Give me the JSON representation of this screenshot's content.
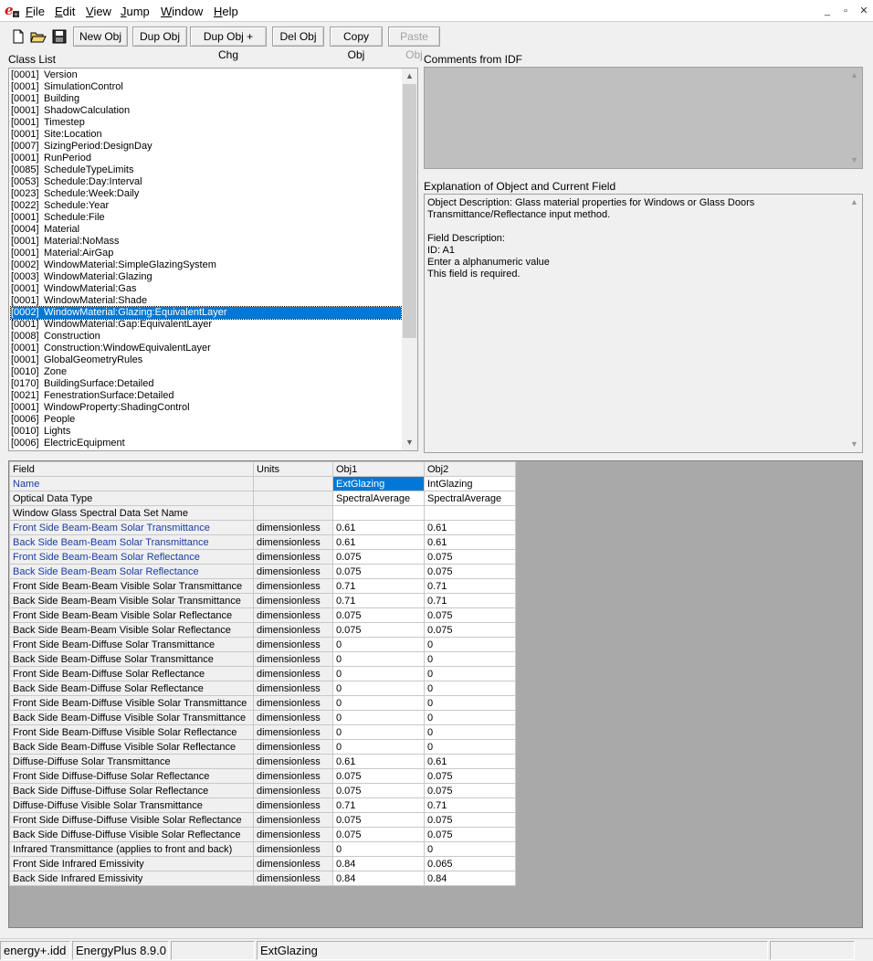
{
  "menu": [
    "File",
    "Edit",
    "View",
    "Jump",
    "Window",
    "Help"
  ],
  "window_buttons": [
    "_",
    "▫",
    "✕"
  ],
  "toolbar": {
    "new_obj": "New Obj",
    "dup_obj": "Dup Obj",
    "dup_obj_chg": "Dup Obj + Chg",
    "del_obj": "Del Obj",
    "copy_obj": "Copy Obj",
    "paste_obj": "Paste Obj"
  },
  "labels": {
    "class_list": "Class List",
    "comments": "Comments from IDF",
    "explanation": "Explanation of Object and Current Field"
  },
  "class_list": [
    {
      "count": "[0001]",
      "name": "Version"
    },
    {
      "count": "[0001]",
      "name": "SimulationControl"
    },
    {
      "count": "[0001]",
      "name": "Building"
    },
    {
      "count": "[0001]",
      "name": "ShadowCalculation"
    },
    {
      "count": "[0001]",
      "name": "Timestep"
    },
    {
      "count": "[0001]",
      "name": "Site:Location"
    },
    {
      "count": "[0007]",
      "name": "SizingPeriod:DesignDay"
    },
    {
      "count": "[0001]",
      "name": "RunPeriod"
    },
    {
      "count": "[0085]",
      "name": "ScheduleTypeLimits"
    },
    {
      "count": "[0053]",
      "name": "Schedule:Day:Interval"
    },
    {
      "count": "[0023]",
      "name": "Schedule:Week:Daily"
    },
    {
      "count": "[0022]",
      "name": "Schedule:Year"
    },
    {
      "count": "[0001]",
      "name": "Schedule:File"
    },
    {
      "count": "[0004]",
      "name": "Material"
    },
    {
      "count": "[0001]",
      "name": "Material:NoMass"
    },
    {
      "count": "[0001]",
      "name": "Material:AirGap"
    },
    {
      "count": "[0002]",
      "name": "WindowMaterial:SimpleGlazingSystem"
    },
    {
      "count": "[0003]",
      "name": "WindowMaterial:Glazing"
    },
    {
      "count": "[0001]",
      "name": "WindowMaterial:Gas"
    },
    {
      "count": "[0001]",
      "name": "WindowMaterial:Shade"
    },
    {
      "count": "[0002]",
      "name": "WindowMaterial:Glazing:EquivalentLayer",
      "selected": true
    },
    {
      "count": "[0001]",
      "name": "WindowMaterial:Gap:EquivalentLayer"
    },
    {
      "count": "[0008]",
      "name": "Construction"
    },
    {
      "count": "[0001]",
      "name": "Construction:WindowEquivalentLayer"
    },
    {
      "count": "[0001]",
      "name": "GlobalGeometryRules"
    },
    {
      "count": "[0010]",
      "name": "Zone"
    },
    {
      "count": "[0170]",
      "name": "BuildingSurface:Detailed"
    },
    {
      "count": "[0021]",
      "name": "FenestrationSurface:Detailed"
    },
    {
      "count": "[0001]",
      "name": "WindowProperty:ShadingControl"
    },
    {
      "count": "[0006]",
      "name": "People"
    },
    {
      "count": "[0010]",
      "name": "Lights"
    },
    {
      "count": "[0006]",
      "name": "ElectricEquipment"
    }
  ],
  "explanation": [
    "Object Description: Glass material properties for Windows or Glass Doors",
    "Transmittance/Reflectance input method.",
    "",
    "Field Description:",
    "ID: A1",
    "Enter a alphanumeric value",
    "This field is required."
  ],
  "grid": {
    "headers": [
      "Field",
      "Units",
      "Obj1",
      "Obj2"
    ],
    "rows": [
      {
        "field": "Name",
        "units": "",
        "obj1": "ExtGlazing",
        "obj2": "IntGlazing",
        "required": true,
        "selected": true
      },
      {
        "field": "Optical Data Type",
        "units": "",
        "obj1": "SpectralAverage",
        "obj2": "SpectralAverage"
      },
      {
        "field": "Window Glass Spectral Data Set Name",
        "units": "",
        "obj1": "",
        "obj2": ""
      },
      {
        "field": "Front Side Beam-Beam Solar Transmittance",
        "units": "dimensionless",
        "obj1": "0.61",
        "obj2": "0.61",
        "required": true
      },
      {
        "field": "Back Side Beam-Beam Solar Transmittance",
        "units": "dimensionless",
        "obj1": "0.61",
        "obj2": "0.61",
        "required": true
      },
      {
        "field": "Front Side Beam-Beam Solar Reflectance",
        "units": "dimensionless",
        "obj1": "0.075",
        "obj2": "0.075",
        "required": true
      },
      {
        "field": "Back Side Beam-Beam Solar Reflectance",
        "units": "dimensionless",
        "obj1": "0.075",
        "obj2": "0.075",
        "required": true
      },
      {
        "field": "Front Side Beam-Beam Visible Solar Transmittance",
        "units": "dimensionless",
        "obj1": "0.71",
        "obj2": "0.71"
      },
      {
        "field": "Back Side Beam-Beam Visible Solar Transmittance",
        "units": "dimensionless",
        "obj1": "0.71",
        "obj2": "0.71"
      },
      {
        "field": "Front Side Beam-Beam Visible Solar Reflectance",
        "units": "dimensionless",
        "obj1": "0.075",
        "obj2": "0.075"
      },
      {
        "field": "Back Side Beam-Beam Visible Solar Reflectance",
        "units": "dimensionless",
        "obj1": "0.075",
        "obj2": "0.075"
      },
      {
        "field": "Front Side Beam-Diffuse Solar Transmittance",
        "units": "dimensionless",
        "obj1": "0",
        "obj2": "0"
      },
      {
        "field": "Back Side Beam-Diffuse Solar Transmittance",
        "units": "dimensionless",
        "obj1": "0",
        "obj2": "0"
      },
      {
        "field": "Front Side Beam-Diffuse Solar Reflectance",
        "units": "dimensionless",
        "obj1": "0",
        "obj2": "0"
      },
      {
        "field": "Back Side Beam-Diffuse Solar Reflectance",
        "units": "dimensionless",
        "obj1": "0",
        "obj2": "0"
      },
      {
        "field": "Front Side Beam-Diffuse Visible Solar Transmittance",
        "units": "dimensionless",
        "obj1": "0",
        "obj2": "0"
      },
      {
        "field": "Back Side Beam-Diffuse Visible Solar Transmittance",
        "units": "dimensionless",
        "obj1": "0",
        "obj2": "0"
      },
      {
        "field": "Front Side Beam-Diffuse Visible Solar Reflectance",
        "units": "dimensionless",
        "obj1": "0",
        "obj2": "0"
      },
      {
        "field": "Back Side Beam-Diffuse Visible Solar Reflectance",
        "units": "dimensionless",
        "obj1": "0",
        "obj2": "0"
      },
      {
        "field": "Diffuse-Diffuse Solar Transmittance",
        "units": "dimensionless",
        "obj1": "0.61",
        "obj2": "0.61"
      },
      {
        "field": "Front Side Diffuse-Diffuse Solar Reflectance",
        "units": "dimensionless",
        "obj1": "0.075",
        "obj2": "0.075"
      },
      {
        "field": "Back Side Diffuse-Diffuse Solar Reflectance",
        "units": "dimensionless",
        "obj1": "0.075",
        "obj2": "0.075"
      },
      {
        "field": "Diffuse-Diffuse Visible Solar Transmittance",
        "units": "dimensionless",
        "obj1": "0.71",
        "obj2": "0.71"
      },
      {
        "field": "Front Side Diffuse-Diffuse Visible Solar Reflectance",
        "units": "dimensionless",
        "obj1": "0.075",
        "obj2": "0.075"
      },
      {
        "field": "Back Side Diffuse-Diffuse Visible Solar Reflectance",
        "units": "dimensionless",
        "obj1": "0.075",
        "obj2": "0.075"
      },
      {
        "field": "Infrared Transmittance (applies to front and back)",
        "units": "dimensionless",
        "obj1": "0",
        "obj2": "0"
      },
      {
        "field": "Front Side Infrared Emissivity",
        "units": "dimensionless",
        "obj1": "0.84",
        "obj2": "0.065"
      },
      {
        "field": "Back Side Infrared Emissivity",
        "units": "dimensionless",
        "obj1": "0.84",
        "obj2": "0.84"
      }
    ]
  },
  "status": {
    "idd": "energy+.idd",
    "version": "EnergyPlus 8.9.0",
    "blank1": "",
    "current_object": "ExtGlazing",
    "blank2": ""
  },
  "colors": {
    "selection": "#0078d7",
    "required_field_text": "#1a3ca0",
    "grid_background": "#a9a9a9"
  }
}
